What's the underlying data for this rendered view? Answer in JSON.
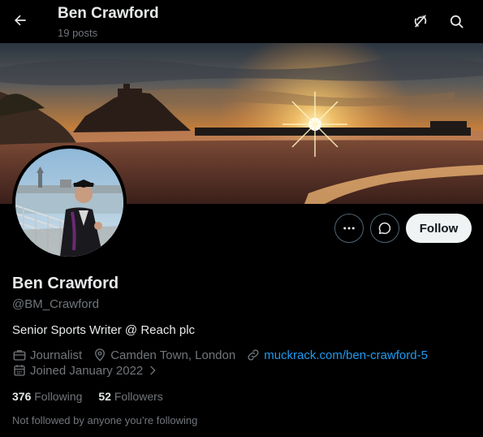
{
  "header": {
    "title": "Ben Crawford",
    "post_count": "19 posts"
  },
  "profile": {
    "display_name": "Ben Crawford",
    "handle": "@BM_Crawford",
    "bio": "Senior Sports Writer @ Reach plc",
    "profession": "Journalist",
    "location": "Camden Town, London",
    "website": "muckrack.com/ben-crawford-5",
    "joined": "Joined January 2022",
    "following_count": "376",
    "following_label": "Following",
    "followers_count": "52",
    "followers_label": "Followers",
    "mutuals_note": "Not followed by anyone you’re following"
  },
  "actions": {
    "follow_label": "Follow"
  },
  "colors": {
    "background": "#000000",
    "primary_text": "#e7e9ea",
    "secondary_text": "#71767b",
    "link": "#1d9bf0",
    "follow_button_bg": "#eff3f4"
  },
  "icons": [
    "back-arrow-icon",
    "grok-icon",
    "search-icon",
    "more-icon",
    "message-icon",
    "briefcase-icon",
    "location-pin-icon",
    "link-icon",
    "calendar-icon",
    "chevron-right-icon"
  ]
}
